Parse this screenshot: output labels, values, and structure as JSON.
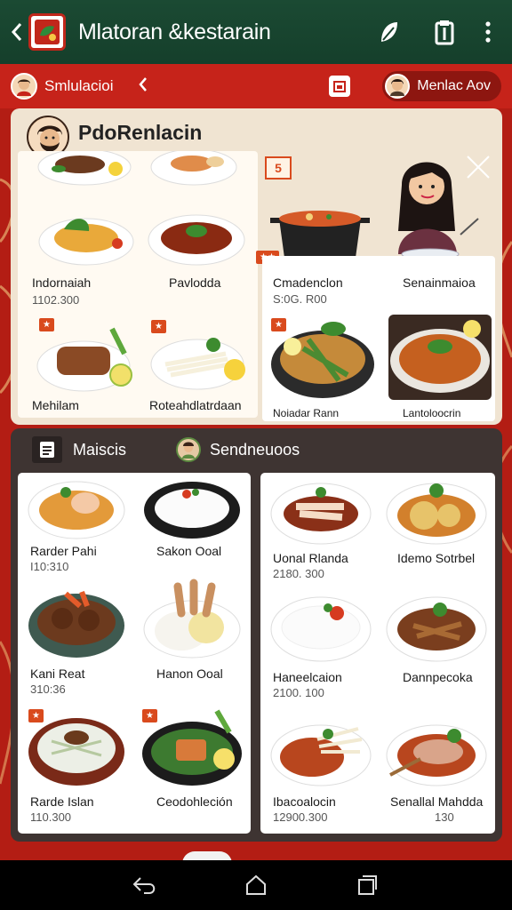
{
  "app_bar": {
    "title": "Mlatoran &kestarain"
  },
  "sub_bar": {
    "title": "Smlulacioi",
    "user_chip_label": "Menlac Aov"
  },
  "top_panel": {
    "title": "PdoRenlacin",
    "badge": "5",
    "left_items": [
      {
        "name": "Indornaiah",
        "price": "1102.300"
      },
      {
        "name": "Pavlodda",
        "price": ""
      },
      {
        "name": "Mehilam",
        "price": ""
      },
      {
        "name": "Roteahdlatrdaan",
        "price": ""
      }
    ],
    "right_items": [
      {
        "name": "Cmadenclon",
        "price": "S:0G. R00"
      },
      {
        "name": "Senainmaioa",
        "price": ""
      },
      {
        "name": "Noiadar Rann",
        "price": ""
      },
      {
        "name": "Lantoloocrin",
        "price": ""
      }
    ]
  },
  "bottom_panel": {
    "tab_1": "Maiscis",
    "tab_2": "Sendneuoos",
    "left_items": [
      {
        "name": "Rarder Pahi",
        "price": "I10:310"
      },
      {
        "name": "Sakon Ooal",
        "price": ""
      },
      {
        "name": "Kani Reat",
        "price": "310:36"
      },
      {
        "name": "Hanon Ooal",
        "price": ""
      },
      {
        "name": "Rarde Islan",
        "price": "110.300"
      },
      {
        "name": "Ceodohleción",
        "price": ""
      }
    ],
    "right_items": [
      {
        "name": "Uonal Rlanda",
        "price": "2180. 300"
      },
      {
        "name": "Idemo Sotrbel",
        "price": ""
      },
      {
        "name": "Haneelcaion",
        "price": "2100. 100"
      },
      {
        "name": "Dannpecoka",
        "price": ""
      },
      {
        "name": "Ibacoalocin",
        "price": "12900.300"
      },
      {
        "name": "Senallal Mahdda",
        "price": "130"
      }
    ]
  },
  "colors": {
    "app_bar": "#1b4a33",
    "brand_red": "#c6231a",
    "panel_cream": "#f0e4d2",
    "panel_dark": "#3e3432"
  },
  "icons": [
    "back-icon",
    "restaurant-logo-icon",
    "leaf-icon",
    "clipboard-icon",
    "more-vert-icon",
    "chevron-left-icon",
    "calendar-icon",
    "menu-icon",
    "close-icon",
    "nav-back-icon",
    "nav-home-icon",
    "nav-recents-icon"
  ]
}
